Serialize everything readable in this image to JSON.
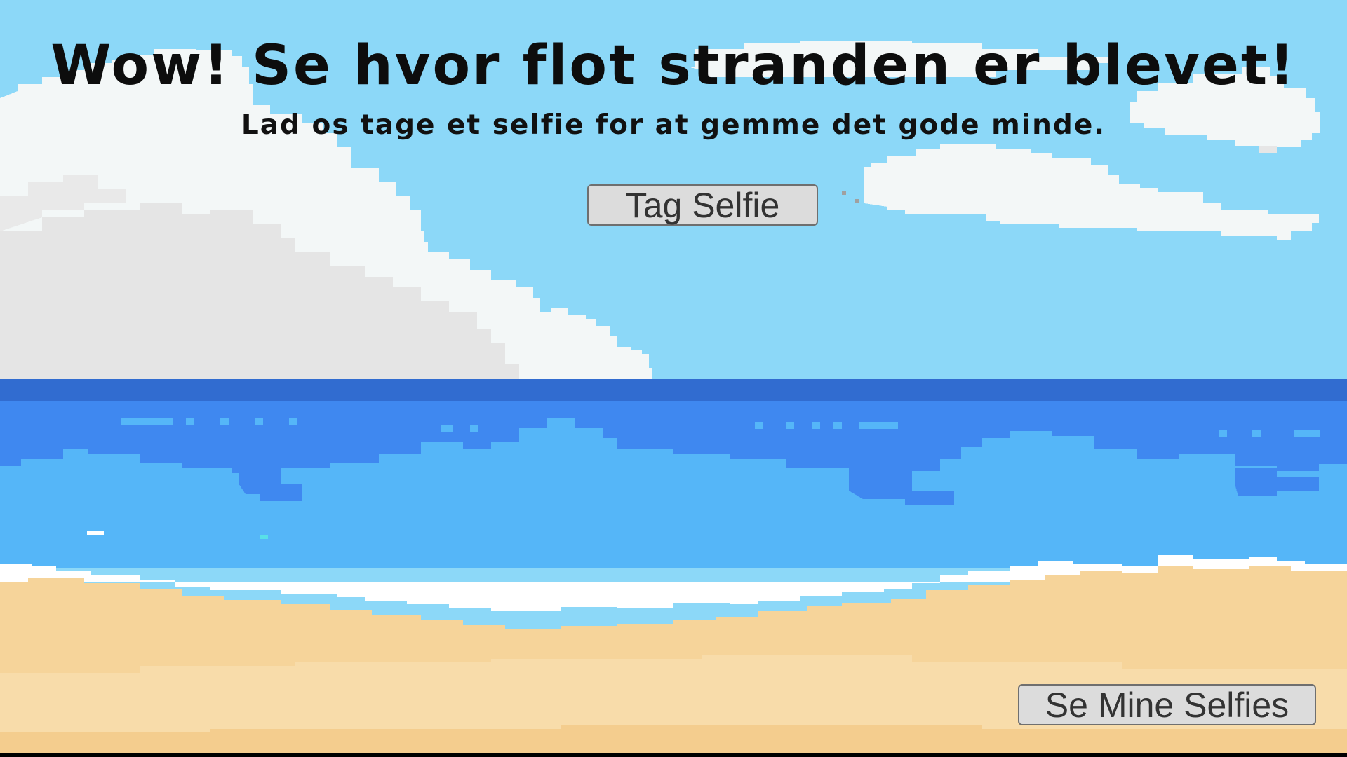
{
  "screen": {
    "title": "Wow! Se hvor flot stranden er blevet!",
    "subtitle": "Lad os tage et selfie for at gemme det gode minde."
  },
  "buttons": {
    "take_selfie": "Tag Selfie",
    "view_selfies": "Se Mine Selfies"
  },
  "colors": {
    "sky": "#8cd8f8",
    "cloud": "#f4f8f8",
    "cloud_shade": "#e6e6e6",
    "sea_far": "#316cd0",
    "sea_mid": "#3f88f0",
    "sea_near": "#55b6f8",
    "foam": "#ffffff",
    "sand": "#f6d49a",
    "button_bg": "#dcdcdc",
    "text": "#0d0d0d"
  }
}
